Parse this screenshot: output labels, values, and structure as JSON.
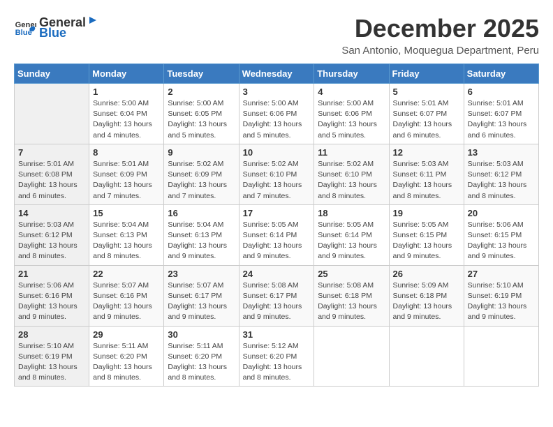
{
  "logo": {
    "text_general": "General",
    "text_blue": "Blue"
  },
  "header": {
    "month": "December 2025",
    "location": "San Antonio, Moquegua Department, Peru"
  },
  "weekdays": [
    "Sunday",
    "Monday",
    "Tuesday",
    "Wednesday",
    "Thursday",
    "Friday",
    "Saturday"
  ],
  "weeks": [
    [
      {
        "day": "",
        "sunrise": "",
        "sunset": "",
        "daylight": ""
      },
      {
        "day": "1",
        "sunrise": "Sunrise: 5:00 AM",
        "sunset": "Sunset: 6:04 PM",
        "daylight": "Daylight: 13 hours and 4 minutes."
      },
      {
        "day": "2",
        "sunrise": "Sunrise: 5:00 AM",
        "sunset": "Sunset: 6:05 PM",
        "daylight": "Daylight: 13 hours and 5 minutes."
      },
      {
        "day": "3",
        "sunrise": "Sunrise: 5:00 AM",
        "sunset": "Sunset: 6:06 PM",
        "daylight": "Daylight: 13 hours and 5 minutes."
      },
      {
        "day": "4",
        "sunrise": "Sunrise: 5:00 AM",
        "sunset": "Sunset: 6:06 PM",
        "daylight": "Daylight: 13 hours and 5 minutes."
      },
      {
        "day": "5",
        "sunrise": "Sunrise: 5:01 AM",
        "sunset": "Sunset: 6:07 PM",
        "daylight": "Daylight: 13 hours and 6 minutes."
      },
      {
        "day": "6",
        "sunrise": "Sunrise: 5:01 AM",
        "sunset": "Sunset: 6:07 PM",
        "daylight": "Daylight: 13 hours and 6 minutes."
      }
    ],
    [
      {
        "day": "7",
        "sunrise": "Sunrise: 5:01 AM",
        "sunset": "Sunset: 6:08 PM",
        "daylight": "Daylight: 13 hours and 6 minutes."
      },
      {
        "day": "8",
        "sunrise": "Sunrise: 5:01 AM",
        "sunset": "Sunset: 6:09 PM",
        "daylight": "Daylight: 13 hours and 7 minutes."
      },
      {
        "day": "9",
        "sunrise": "Sunrise: 5:02 AM",
        "sunset": "Sunset: 6:09 PM",
        "daylight": "Daylight: 13 hours and 7 minutes."
      },
      {
        "day": "10",
        "sunrise": "Sunrise: 5:02 AM",
        "sunset": "Sunset: 6:10 PM",
        "daylight": "Daylight: 13 hours and 7 minutes."
      },
      {
        "day": "11",
        "sunrise": "Sunrise: 5:02 AM",
        "sunset": "Sunset: 6:10 PM",
        "daylight": "Daylight: 13 hours and 8 minutes."
      },
      {
        "day": "12",
        "sunrise": "Sunrise: 5:03 AM",
        "sunset": "Sunset: 6:11 PM",
        "daylight": "Daylight: 13 hours and 8 minutes."
      },
      {
        "day": "13",
        "sunrise": "Sunrise: 5:03 AM",
        "sunset": "Sunset: 6:12 PM",
        "daylight": "Daylight: 13 hours and 8 minutes."
      }
    ],
    [
      {
        "day": "14",
        "sunrise": "Sunrise: 5:03 AM",
        "sunset": "Sunset: 6:12 PM",
        "daylight": "Daylight: 13 hours and 8 minutes."
      },
      {
        "day": "15",
        "sunrise": "Sunrise: 5:04 AM",
        "sunset": "Sunset: 6:13 PM",
        "daylight": "Daylight: 13 hours and 8 minutes."
      },
      {
        "day": "16",
        "sunrise": "Sunrise: 5:04 AM",
        "sunset": "Sunset: 6:13 PM",
        "daylight": "Daylight: 13 hours and 9 minutes."
      },
      {
        "day": "17",
        "sunrise": "Sunrise: 5:05 AM",
        "sunset": "Sunset: 6:14 PM",
        "daylight": "Daylight: 13 hours and 9 minutes."
      },
      {
        "day": "18",
        "sunrise": "Sunrise: 5:05 AM",
        "sunset": "Sunset: 6:14 PM",
        "daylight": "Daylight: 13 hours and 9 minutes."
      },
      {
        "day": "19",
        "sunrise": "Sunrise: 5:05 AM",
        "sunset": "Sunset: 6:15 PM",
        "daylight": "Daylight: 13 hours and 9 minutes."
      },
      {
        "day": "20",
        "sunrise": "Sunrise: 5:06 AM",
        "sunset": "Sunset: 6:15 PM",
        "daylight": "Daylight: 13 hours and 9 minutes."
      }
    ],
    [
      {
        "day": "21",
        "sunrise": "Sunrise: 5:06 AM",
        "sunset": "Sunset: 6:16 PM",
        "daylight": "Daylight: 13 hours and 9 minutes."
      },
      {
        "day": "22",
        "sunrise": "Sunrise: 5:07 AM",
        "sunset": "Sunset: 6:16 PM",
        "daylight": "Daylight: 13 hours and 9 minutes."
      },
      {
        "day": "23",
        "sunrise": "Sunrise: 5:07 AM",
        "sunset": "Sunset: 6:17 PM",
        "daylight": "Daylight: 13 hours and 9 minutes."
      },
      {
        "day": "24",
        "sunrise": "Sunrise: 5:08 AM",
        "sunset": "Sunset: 6:17 PM",
        "daylight": "Daylight: 13 hours and 9 minutes."
      },
      {
        "day": "25",
        "sunrise": "Sunrise: 5:08 AM",
        "sunset": "Sunset: 6:18 PM",
        "daylight": "Daylight: 13 hours and 9 minutes."
      },
      {
        "day": "26",
        "sunrise": "Sunrise: 5:09 AM",
        "sunset": "Sunset: 6:18 PM",
        "daylight": "Daylight: 13 hours and 9 minutes."
      },
      {
        "day": "27",
        "sunrise": "Sunrise: 5:10 AM",
        "sunset": "Sunset: 6:19 PM",
        "daylight": "Daylight: 13 hours and 9 minutes."
      }
    ],
    [
      {
        "day": "28",
        "sunrise": "Sunrise: 5:10 AM",
        "sunset": "Sunset: 6:19 PM",
        "daylight": "Daylight: 13 hours and 8 minutes."
      },
      {
        "day": "29",
        "sunrise": "Sunrise: 5:11 AM",
        "sunset": "Sunset: 6:20 PM",
        "daylight": "Daylight: 13 hours and 8 minutes."
      },
      {
        "day": "30",
        "sunrise": "Sunrise: 5:11 AM",
        "sunset": "Sunset: 6:20 PM",
        "daylight": "Daylight: 13 hours and 8 minutes."
      },
      {
        "day": "31",
        "sunrise": "Sunrise: 5:12 AM",
        "sunset": "Sunset: 6:20 PM",
        "daylight": "Daylight: 13 hours and 8 minutes."
      },
      {
        "day": "",
        "sunrise": "",
        "sunset": "",
        "daylight": ""
      },
      {
        "day": "",
        "sunrise": "",
        "sunset": "",
        "daylight": ""
      },
      {
        "day": "",
        "sunrise": "",
        "sunset": "",
        "daylight": ""
      }
    ]
  ]
}
